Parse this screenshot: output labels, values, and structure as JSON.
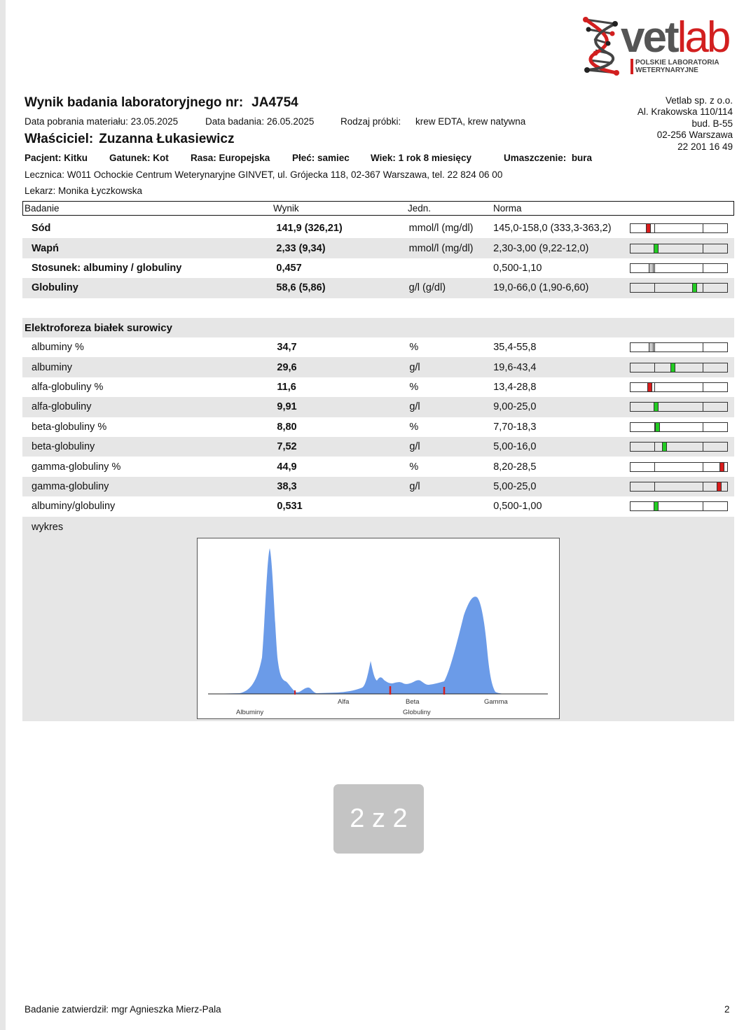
{
  "logo": {
    "brand_dark": "vet",
    "brand_red": "lab",
    "subtitle_line1": "POLSKIE LABORATORIA",
    "subtitle_line2": "WETERYNARYJNE",
    "colors": {
      "red": "#d21f1f",
      "gray": "#555555"
    }
  },
  "company": {
    "name": "Vetlab sp. z o.o.",
    "street": "Al. Krakowska 110/114",
    "building": "bud. B-55",
    "city": "02-256 Warszawa",
    "phone": "22 201 16 49"
  },
  "header": {
    "title_label": "Wynik badania laboratoryjnego nr:",
    "report_number": "JA4754",
    "collection_label": "Data pobrania materiału:",
    "collection_date": "23.05.2025",
    "test_label": "Data badania:",
    "test_date": "26.05.2025",
    "sample_label": "Rodzaj próbki:",
    "sample_type": "krew EDTA, krew natywna",
    "owner_label": "Właściciel:",
    "owner_name": "Zuzanna Łukasiewicz",
    "patient": "Pacjent: Kitku",
    "species": "Gatunek: Kot",
    "breed": "Rasa: Europejska",
    "sex": "Płeć: samiec",
    "age": "Wiek: 1 rok 8 miesięcy",
    "coat_label": "Umaszczenie:",
    "coat_value": "bura",
    "clinic": "Lecznica:  W011 Ochockie Centrum Weterynaryjne GINVET, ul. Grójecka 118, 02-367 Warszawa, tel. 22 824 06 00",
    "doctor": "Lekarz: Monika Łyczkowska"
  },
  "table_header": {
    "col_test": "Badanie",
    "col_result": "Wynik",
    "col_unit": "Jedn.",
    "col_norm": "Norma"
  },
  "results": [
    {
      "name": "Sód",
      "value": "141,9 (326,21)",
      "unit": "mmol/l (mg/dl)",
      "norm": "145,0-158,0 (333,3-363,2)",
      "marker": 0.185,
      "status": "low",
      "shade": false
    },
    {
      "name": "Wapń",
      "value": "2,33 (9,34)",
      "unit": "mmol/l (mg/dl)",
      "norm": "2,30-3,00 (9,22-12,0)",
      "marker": 0.265,
      "status": "normal",
      "shade": true
    },
    {
      "name": "Stosunek: albuminy / globuliny",
      "value": "0,457",
      "unit": "",
      "norm": "0,500-1,10",
      "marker": 0.215,
      "status": "low-gray",
      "shade": false
    },
    {
      "name": "Globuliny",
      "value": "58,6 (5,86)",
      "unit": "g/l (g/dl)",
      "norm": "19,0-66,0 (1,90-6,60)",
      "marker": 0.665,
      "status": "normal",
      "shade": true
    }
  ],
  "electrophoresis": {
    "section_title": "Elektroforeza białek surowicy",
    "rows": [
      {
        "name": "albuminy %",
        "value": "34,7",
        "unit": "%",
        "norm": "35,4-55,8",
        "marker": 0.215,
        "status": "low-gray",
        "shade": false
      },
      {
        "name": "albuminy",
        "value": "29,6",
        "unit": "g/l",
        "norm": "19,6-43,4",
        "marker": 0.44,
        "status": "normal",
        "shade": true
      },
      {
        "name": "alfa-globuliny %",
        "value": "11,6",
        "unit": "%",
        "norm": "13,4-28,8",
        "marker": 0.2,
        "status": "low",
        "shade": false
      },
      {
        "name": "alfa-globuliny",
        "value": "9,91",
        "unit": "g/l",
        "norm": "9,00-25,0",
        "marker": 0.265,
        "status": "normal",
        "shade": true
      },
      {
        "name": "beta-globuliny %",
        "value": "8,80",
        "unit": "%",
        "norm": "7,70-18,3",
        "marker": 0.28,
        "status": "normal",
        "shade": false
      },
      {
        "name": "beta-globuliny",
        "value": "7,52",
        "unit": "g/l",
        "norm": "5,00-16,0",
        "marker": 0.35,
        "status": "normal",
        "shade": true
      },
      {
        "name": "gamma-globuliny %",
        "value": "44,9",
        "unit": "%",
        "norm": "8,20-28,5",
        "marker": 0.945,
        "status": "high",
        "shade": false
      },
      {
        "name": "gamma-globuliny",
        "value": "38,3",
        "unit": "g/l",
        "norm": "5,00-25,0",
        "marker": 0.92,
        "status": "high",
        "shade": true
      },
      {
        "name": "albuminy/globuliny",
        "value": "0,531",
        "unit": "",
        "norm": "0,500-1,00",
        "marker": 0.265,
        "status": "normal",
        "shade": false
      }
    ],
    "graph_label": "wykres",
    "graph_labels": {
      "albuminy": "Albuminy",
      "alfa": "Alfa",
      "beta": "Beta",
      "gamma": "Gamma",
      "globuliny": "Globuliny"
    },
    "graph_colors": {
      "fill": "#6b9be8",
      "divider": "#d42020"
    }
  },
  "status_colors": {
    "normal": "#22cc22",
    "low": "#d81c1c",
    "high": "#d81c1c",
    "low-gray": "#c8c8c8"
  },
  "page_indicator": "2 z 2",
  "footer": {
    "approved": "Badanie  zatwierdził:  mgr  Agnieszka  Mierz-Pala",
    "page_number": "2"
  }
}
